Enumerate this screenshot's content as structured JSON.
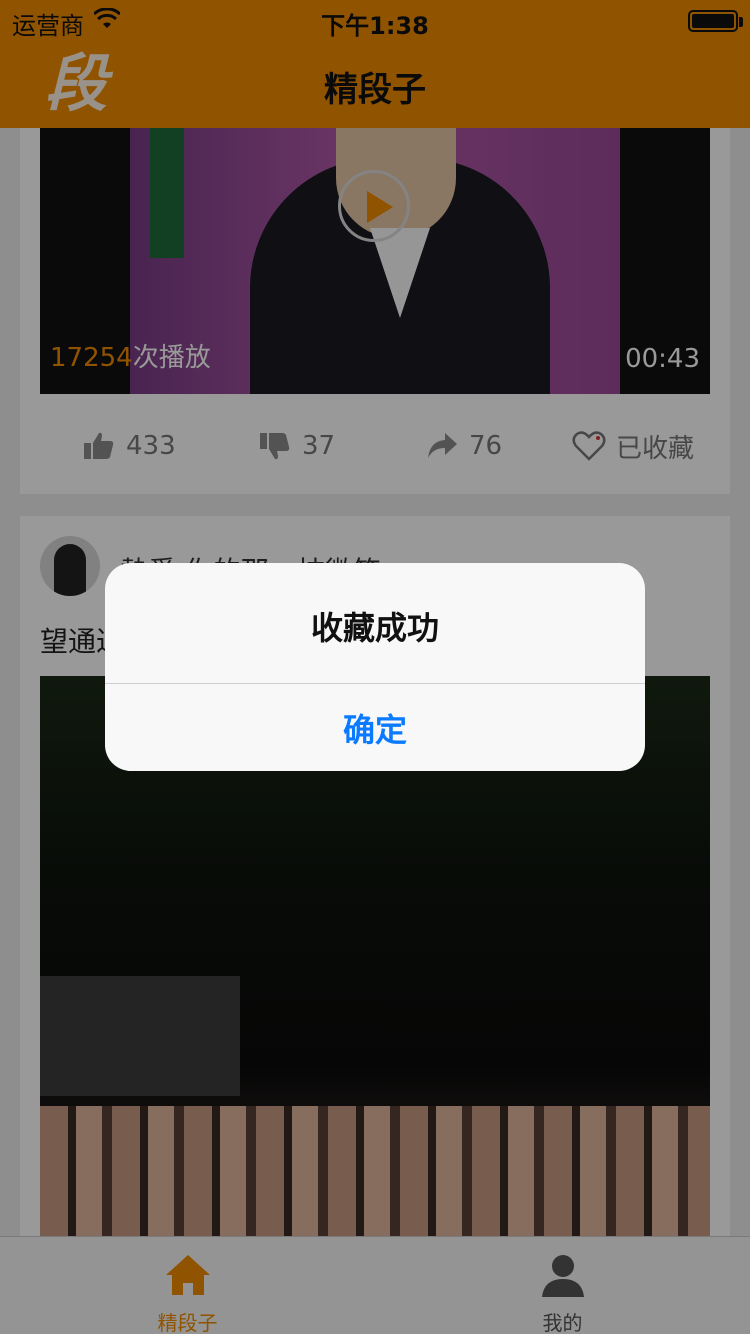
{
  "status_bar": {
    "carrier": "运营商",
    "time": "下午1:38"
  },
  "nav": {
    "logo_text": "段",
    "title": "精段子"
  },
  "feed": {
    "video_post": {
      "play_count": "17254",
      "play_suffix": "次播放",
      "duration": "00:43",
      "actions": {
        "like": "433",
        "dislike": "37",
        "share": "76",
        "favorite": "已收藏"
      }
    },
    "photo_post": {
      "username": "熱愛 你的那一抹微笑",
      "text": "望通过"
    }
  },
  "tabbar": {
    "home_label": "精段子",
    "me_label": "我的"
  },
  "alert": {
    "title": "收藏成功",
    "confirm": "确定"
  },
  "colors": {
    "accent": "#f08a00",
    "alert_button": "#0a7aff"
  }
}
